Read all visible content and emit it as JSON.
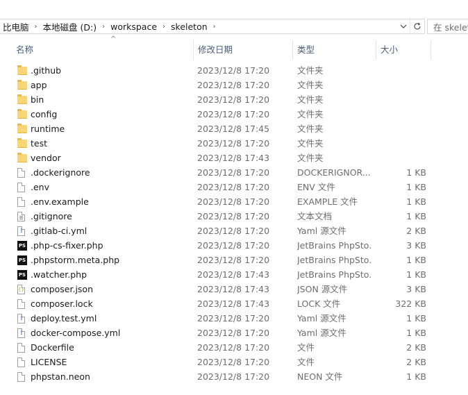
{
  "address": {
    "crumbs": [
      "比电脑",
      "本地磁盘 (D:)",
      "workspace",
      "skeleton"
    ]
  },
  "search": {
    "placeholder": "在 skelet"
  },
  "columns": {
    "name": "名称",
    "date": "修改日期",
    "type": "类型",
    "size": "大小"
  },
  "files": [
    {
      "name": ".github",
      "date": "2023/12/8 17:20",
      "type": "文件夹",
      "size": "",
      "icon": "folder-icon"
    },
    {
      "name": "app",
      "date": "2023/12/8 17:20",
      "type": "文件夹",
      "size": "",
      "icon": "folder-icon"
    },
    {
      "name": "bin",
      "date": "2023/12/8 17:20",
      "type": "文件夹",
      "size": "",
      "icon": "folder-icon"
    },
    {
      "name": "config",
      "date": "2023/12/8 17:20",
      "type": "文件夹",
      "size": "",
      "icon": "folder-icon"
    },
    {
      "name": "runtime",
      "date": "2023/12/8 17:45",
      "type": "文件夹",
      "size": "",
      "icon": "folder-icon"
    },
    {
      "name": "test",
      "date": "2023/12/8 17:20",
      "type": "文件夹",
      "size": "",
      "icon": "folder-icon"
    },
    {
      "name": "vendor",
      "date": "2023/12/8 17:43",
      "type": "文件夹",
      "size": "",
      "icon": "folder-icon"
    },
    {
      "name": ".dockerignore",
      "date": "2023/12/8 17:20",
      "type": "DOCKERIGNOR...",
      "size": "1 KB",
      "icon": "file-icon"
    },
    {
      "name": ".env",
      "date": "2023/12/8 17:20",
      "type": "ENV 文件",
      "size": "1 KB",
      "icon": "file-icon"
    },
    {
      "name": ".env.example",
      "date": "2023/12/8 17:20",
      "type": "EXAMPLE 文件",
      "size": "1 KB",
      "icon": "file-icon"
    },
    {
      "name": ".gitignore",
      "date": "2023/12/8 17:20",
      "type": "文本文档",
      "size": "1 KB",
      "icon": "text-file-icon"
    },
    {
      "name": ".gitlab-ci.yml",
      "date": "2023/12/8 17:20",
      "type": "Yaml 源文件",
      "size": "2 KB",
      "icon": "yaml-file-icon"
    },
    {
      "name": ".php-cs-fixer.php",
      "date": "2023/12/8 17:20",
      "type": "JetBrains PhpSto...",
      "size": "3 KB",
      "icon": "phpstorm-icon"
    },
    {
      "name": ".phpstorm.meta.php",
      "date": "2023/12/8 17:20",
      "type": "JetBrains PhpSto...",
      "size": "1 KB",
      "icon": "phpstorm-icon"
    },
    {
      "name": ".watcher.php",
      "date": "2023/12/8 17:43",
      "type": "JetBrains PhpSto...",
      "size": "1 KB",
      "icon": "phpstorm-icon"
    },
    {
      "name": "composer.json",
      "date": "2023/12/8 17:43",
      "type": "JSON 源文件",
      "size": "3 KB",
      "icon": "json-file-icon"
    },
    {
      "name": "composer.lock",
      "date": "2023/12/8 17:43",
      "type": "LOCK 文件",
      "size": "322 KB",
      "icon": "file-icon"
    },
    {
      "name": "deploy.test.yml",
      "date": "2023/12/8 17:20",
      "type": "Yaml 源文件",
      "size": "1 KB",
      "icon": "yaml-file-icon"
    },
    {
      "name": "docker-compose.yml",
      "date": "2023/12/8 17:20",
      "type": "Yaml 源文件",
      "size": "1 KB",
      "icon": "yaml-file-icon"
    },
    {
      "name": "Dockerfile",
      "date": "2023/12/8 17:20",
      "type": "文件",
      "size": "2 KB",
      "icon": "file-icon"
    },
    {
      "name": "LICENSE",
      "date": "2023/12/8 17:20",
      "type": "文件",
      "size": "2 KB",
      "icon": "file-icon"
    },
    {
      "name": "phpstan.neon",
      "date": "2023/12/8 17:20",
      "type": "NEON 文件",
      "size": "1 KB",
      "icon": "file-icon"
    }
  ],
  "colors": {
    "folder": "#f8d676",
    "header_text": "#4c607a",
    "meta_text": "#6d6d6d"
  }
}
